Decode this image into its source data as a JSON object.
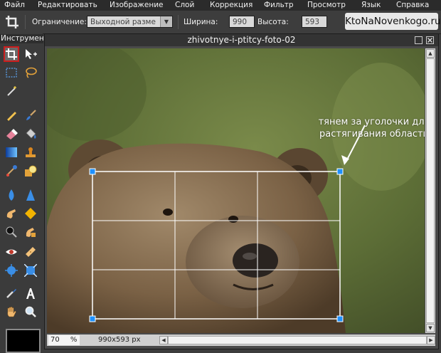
{
  "menu": [
    "Файл",
    "Редактировать",
    "Изображение",
    "Слой",
    "Коррекция",
    "Фильтр",
    "Просмотр",
    "Язык",
    "Справка"
  ],
  "options": {
    "constraint_label": "Ограничение:",
    "constraint_value": "Выходной разме",
    "width_label": "Ширина:",
    "width_value": "990",
    "height_label": "Высота:",
    "height_value": "593"
  },
  "brand": "KtoNaNovenkogo.ru",
  "tools": {
    "title": "Инструменты",
    "items": [
      "crop",
      "move",
      "marquee",
      "lasso",
      "magic-wand",
      "pencil",
      "brush",
      "eraser",
      "paint-bucket",
      "gradient",
      "clone-stamp",
      "color-replace",
      "drawing-shapes",
      "blur",
      "sharpen",
      "smudge",
      "sponge",
      "burn",
      "dodge",
      "red-eye",
      "spot-heal",
      "bloat",
      "pinch",
      "color-picker",
      "type",
      "hand",
      "zoom"
    ]
  },
  "document": {
    "title": "zhivotnye-i-ptitcy-foto-02",
    "zoom_value": "70",
    "zoom_unit": "%",
    "dimensions": "990x593 px"
  },
  "annotation": "тянем за уголочки для растягивания области",
  "colors": {
    "active_tool_border": "#cc1d1d",
    "crop_handle": "#1e90ff",
    "primary_color": "#000000"
  }
}
